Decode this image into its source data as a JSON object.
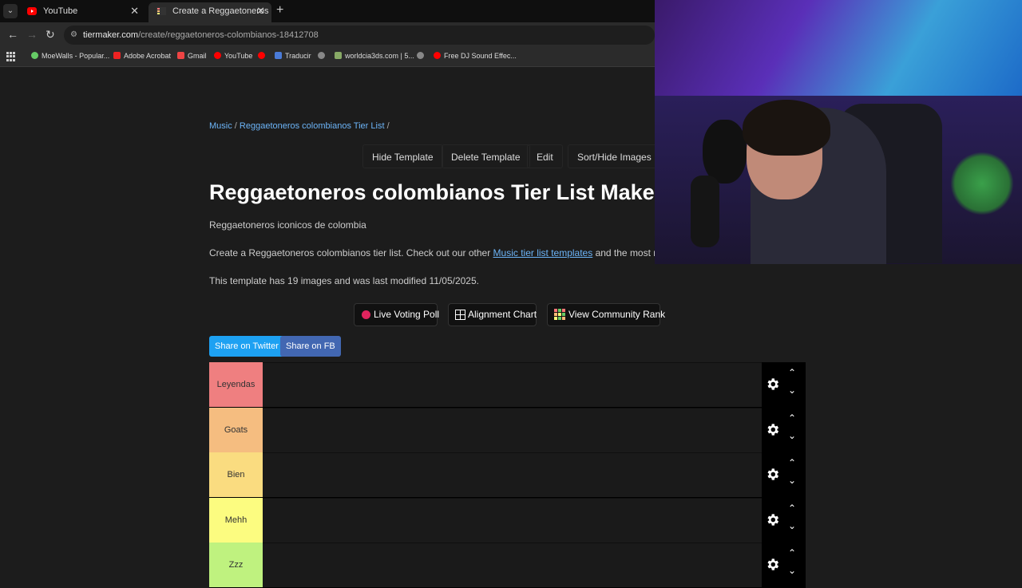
{
  "browser": {
    "tabs": [
      {
        "title": "YouTube",
        "active": false
      },
      {
        "title": "Create a Reggaetoneros colom",
        "active": true
      }
    ],
    "url_host": "tiermaker.com",
    "url_path": "/create/reggaetoneros-colombianos-18412708",
    "bookmarks": [
      "MoeWalls - Popular...",
      "Adobe Acrobat",
      "Gmail",
      "YouTube",
      "",
      "Traducir",
      "",
      "worldcia3ds.com | 5...",
      "",
      "Free DJ Sound Effec..."
    ]
  },
  "breadcrumb": {
    "music": "Music",
    "sep1": " / ",
    "list": "Reggaetoneros colombianos Tier List",
    "sep2": " /"
  },
  "actions": {
    "hide": "Hide Template",
    "delete": "Delete Template",
    "edit": "Edit",
    "sort": "Sort/Hide Images"
  },
  "title": "Reggaetoneros colombianos Tier List Maker",
  "description": "Reggaetoneros iconicos de colombia",
  "intro": {
    "before": "Create a Reggaetoneros colombianos tier list. Check out our other ",
    "link": "Music tier list templates",
    "after": " and the most recent"
  },
  "meta": "This template has 19 images and was last modified 11/05/2025.",
  "buttons": {
    "poll": "Live Voting Poll",
    "alignment": "Alignment Chart",
    "community": "View Community Rank"
  },
  "share": {
    "twitter": "Share on Twitter",
    "fb": "Share on FB"
  },
  "tiers": [
    {
      "label": "Leyendas",
      "color": "#ef7f80"
    },
    {
      "label": "Goats",
      "color": "#f5bd80"
    },
    {
      "label": "Bien",
      "color": "#fadc80"
    },
    {
      "label": "Mehh",
      "color": "#fcfc80"
    },
    {
      "label": "Zzz",
      "color": "#bff27f"
    }
  ],
  "colors": {
    "link": "#6cb4f7",
    "twitter": "#1da1f2",
    "fb": "#4267b2"
  }
}
